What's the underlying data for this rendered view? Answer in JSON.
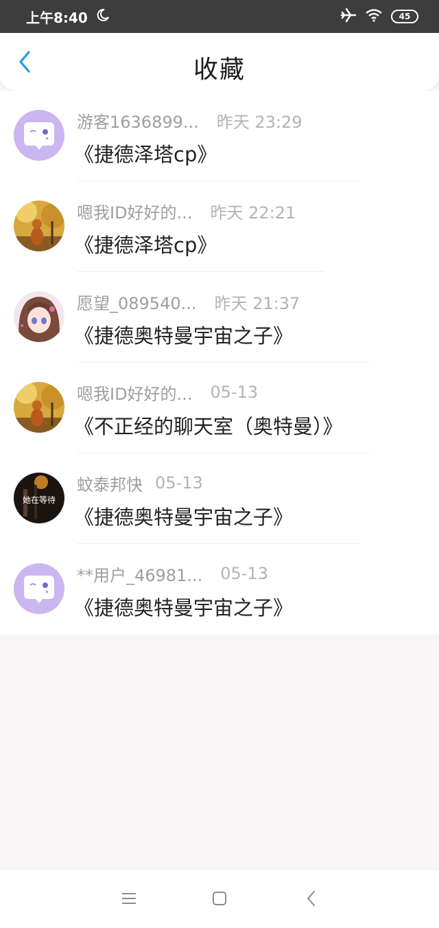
{
  "status_bar": {
    "time": "上午8:40",
    "icons": [
      "moon-icon",
      "airplane-icon",
      "wifi-icon",
      "battery-icon"
    ],
    "battery": "45"
  },
  "header": {
    "title": "收藏",
    "back_icon": "chevron-left-icon"
  },
  "colors": {
    "accent": "#1e9be8",
    "status_bar_bg": "#3d3d3d",
    "avatar_purple": "#cbb6f0"
  },
  "favorites": [
    {
      "user": "游客1636899...",
      "time": "昨天 23:29",
      "title": "《捷德泽塔cp》",
      "avatar": "default-avatar"
    },
    {
      "user": "嗯我ID好好的...",
      "time": "昨天 22:21",
      "title": "《捷德泽塔cp》",
      "avatar": "dog-photo-avatar"
    },
    {
      "user": "愿望_089540...",
      "time": "昨天 21:37",
      "title": "《捷德奥特曼宇宙之子》",
      "avatar": "anime-girl-avatar"
    },
    {
      "user": "嗯我ID好好的...",
      "time": "05-13",
      "title": "《不正经的聊天室（奥特曼）》",
      "avatar": "dog-photo-avatar"
    },
    {
      "user": "蚊泰邦快",
      "time": "05-13",
      "title": "《捷德奥特曼宇宙之子》",
      "avatar": "night-photo-avatar",
      "avatar_text": "她在等待"
    },
    {
      "user": "**用户_46981...",
      "time": "05-13",
      "title": "《捷德奥特曼宇宙之子》",
      "avatar": "default-avatar"
    }
  ],
  "nav_bar": {
    "icons": [
      "menu-icon",
      "home-square-icon",
      "back-icon"
    ]
  }
}
